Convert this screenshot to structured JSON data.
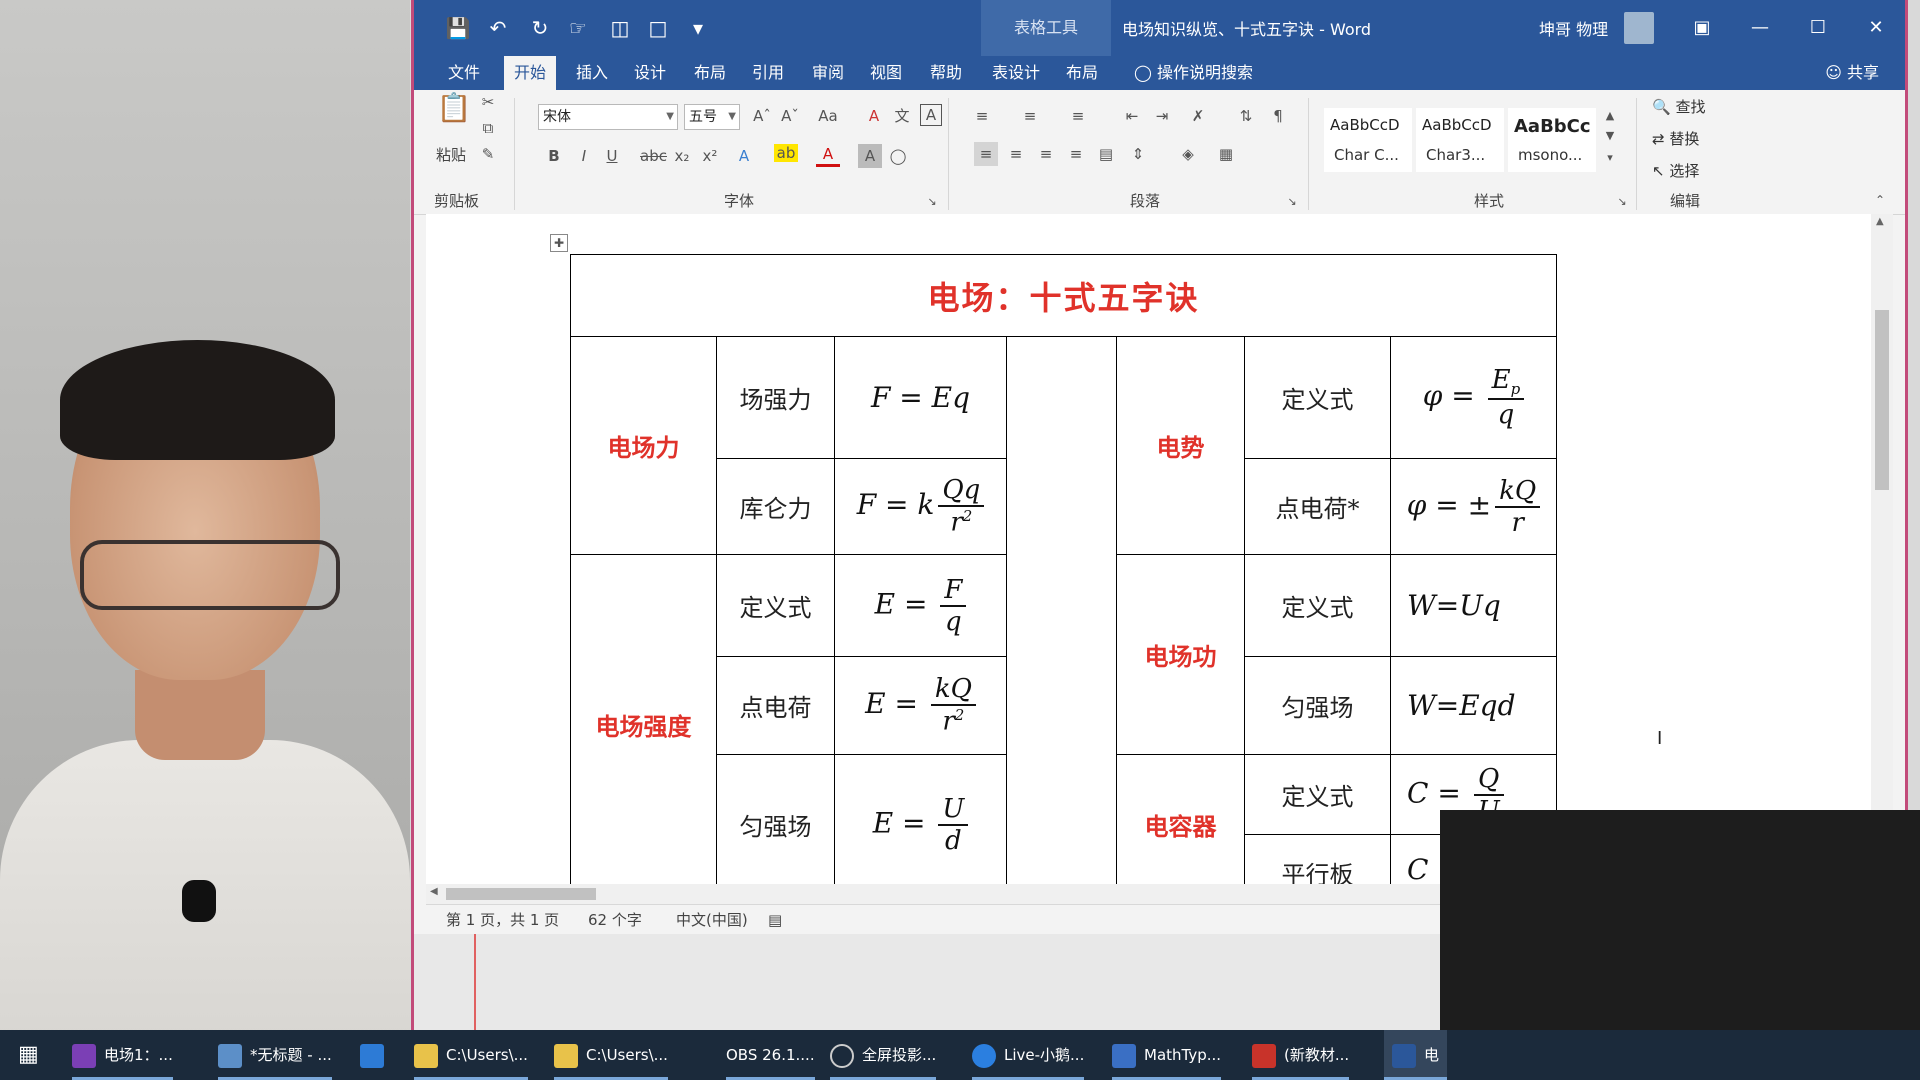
{
  "title_bar": {
    "context_tab": "表格工具",
    "document_title": "电场知识纵览、十式五字诀 - Word",
    "user": "坤哥 物理"
  },
  "ribbon_tabs": [
    "文件",
    "开始",
    "插入",
    "设计",
    "布局",
    "引用",
    "审阅",
    "视图",
    "帮助",
    "表设计",
    "布局"
  ],
  "active_tab": "开始",
  "tell_me": "操作说明搜索",
  "share": "共享",
  "clipboard": {
    "paste": "粘贴",
    "group": "剪贴板"
  },
  "font": {
    "name": "宋体",
    "size": "五号",
    "group": "字体"
  },
  "paragraph": {
    "group": "段落"
  },
  "styles": {
    "group": "样式",
    "items": [
      {
        "sample": "AaBbCcD",
        "name": "Char C..."
      },
      {
        "sample": "AaBbCcD",
        "name": "Char3..."
      },
      {
        "sample": "AaBbCc",
        "name": "msono..."
      }
    ]
  },
  "editing": {
    "find": "查找",
    "replace": "替换",
    "select": "选择",
    "group": "编辑"
  },
  "table": {
    "title": "电场：十式五字诀",
    "left": {
      "force": {
        "cat": "电场力",
        "r1_label": "场强力",
        "r2_label": "库仑力"
      },
      "field": {
        "cat": "电场强度",
        "r1_label": "定义式",
        "r2_label": "点电荷",
        "r3_label": "匀强场"
      }
    },
    "right": {
      "potential": {
        "cat": "电势",
        "r1_label": "定义式",
        "r2_label": "点电荷*"
      },
      "work": {
        "cat": "电场功",
        "r1_label": "定义式",
        "r2_label": "匀强场"
      },
      "capacitor": {
        "cat": "电容器",
        "r1_label": "定义式",
        "r2_label": "平行板"
      }
    }
  },
  "status": {
    "page": "第 1 页，共 1 页",
    "words": "62 个字",
    "lang": "中文(中国)"
  },
  "taskbar": [
    {
      "label": "电场1：...",
      "color": "#7b3fb5"
    },
    {
      "label": "*无标题 - ...",
      "color": "#5c8fc8"
    },
    {
      "label": "",
      "color": "#2d7bd6"
    },
    {
      "label": "C:\\Users\\...",
      "color": "#e8c24a"
    },
    {
      "label": "C:\\Users\\...",
      "color": "#e8c24a"
    },
    {
      "label": "OBS 26.1....",
      "color": ""
    },
    {
      "label": "全屏投影...",
      "color": "#444444"
    },
    {
      "label": "Live-小鹅...",
      "color": "#2b7fe0"
    },
    {
      "label": "MathTyp...",
      "color": "#3a6fc4"
    },
    {
      "label": "(新教材...",
      "color": "#c8332a"
    },
    {
      "label": "电",
      "color": "#2b579a"
    }
  ]
}
